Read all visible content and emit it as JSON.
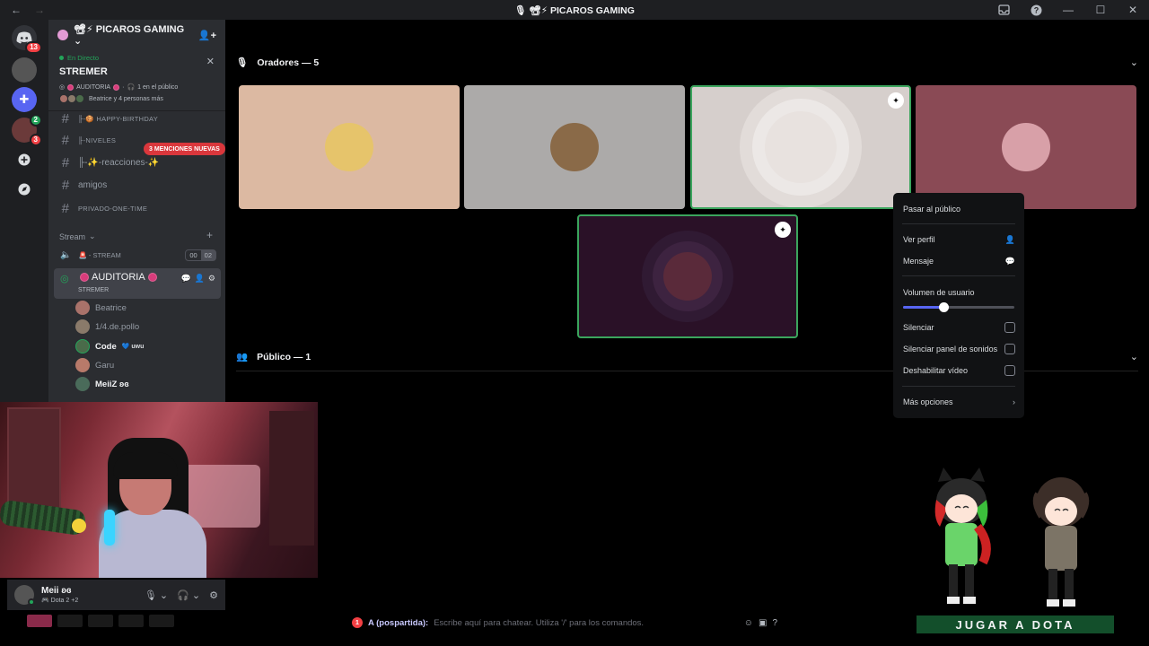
{
  "titlebar": {
    "back": "←",
    "forward": "→",
    "title": "PICAROS GAMING"
  },
  "rail": {
    "badges": [
      "13",
      "2",
      "3"
    ]
  },
  "server": {
    "name": "PICAROS GAMING"
  },
  "live": {
    "status": "En Directo",
    "title": "STREMER",
    "channel": "AUDITORIA",
    "audience": "1 en el público",
    "who": "Beatrice y 4 personas más"
  },
  "channels": [
    {
      "name": "╟-🍪 HAPPY-BIRTHDAY",
      "small": true
    },
    {
      "name": "╟-NIVELES",
      "small": true
    },
    {
      "name": "╟-✨-reacciones-✨",
      "small": false
    },
    {
      "name": "amigos",
      "small": false
    },
    {
      "name": "PRIVADO-ONE-TIME",
      "small": true
    }
  ],
  "mentions_badge": "3 MENCIONES NUEVAS",
  "category": {
    "name": "Stream"
  },
  "stream_channel": {
    "name": "🚨 - STREAM",
    "counter_a": "00",
    "counter_b": "02"
  },
  "auditoria": {
    "name": "AUDITORIA",
    "sub": "STREMER"
  },
  "members": [
    {
      "name": "Beatrice",
      "color": "#a9726a",
      "bold": false,
      "tag": ""
    },
    {
      "name": "1/4.de.pollo",
      "color": "#8a7a6a",
      "bold": false,
      "tag": ""
    },
    {
      "name": "Code",
      "color": "#4a6b4a",
      "bold": true,
      "tag": "💙 uwu"
    },
    {
      "name": "Garu",
      "color": "#b87a6a",
      "bold": false,
      "tag": ""
    },
    {
      "name": "MeiiZ ʚɞ",
      "color": "#4a6b5a",
      "bold": true,
      "tag": ""
    }
  ],
  "stage": {
    "speakers_label": "Oradores — 5",
    "audience_label": "Público — 1"
  },
  "tiles": [
    {
      "bg": "#dcb9a2",
      "avatar": "#e6c46b",
      "speaking": false,
      "mod": false
    },
    {
      "bg": "#acaaa9",
      "avatar": "#8a6a48",
      "speaking": false,
      "mod": false
    },
    {
      "bg": "#d6cfcc",
      "avatar": "#e8e2df",
      "speaking": true,
      "mod": true
    },
    {
      "bg": "#8a4a55",
      "avatar": "#d8a0a8",
      "speaking": false,
      "mod": false
    },
    {
      "bg": "#2a1127",
      "avatar": "#5a2a3a",
      "speaking": true,
      "mod": true
    }
  ],
  "context_menu": {
    "move_to_audience": "Pasar al público",
    "view_profile": "Ver perfil",
    "message": "Mensaje",
    "volume_label": "Volumen de usuario",
    "volume_value": 0.36,
    "mute": "Silenciar",
    "mute_soundboard": "Silenciar panel de sonidos",
    "disable_video": "Deshabilitar vídeo",
    "more_options": "Más opciones"
  },
  "user": {
    "name": "Meii ʚɞ",
    "status": "🎮 Dota 2 +2"
  },
  "chat": {
    "badge": "1",
    "user": "A (pospartida):",
    "placeholder": "Escribe aquí para chatear. Utiliza '/' para los comandos."
  },
  "banner": {
    "text": "JUGAR A DOTA"
  }
}
